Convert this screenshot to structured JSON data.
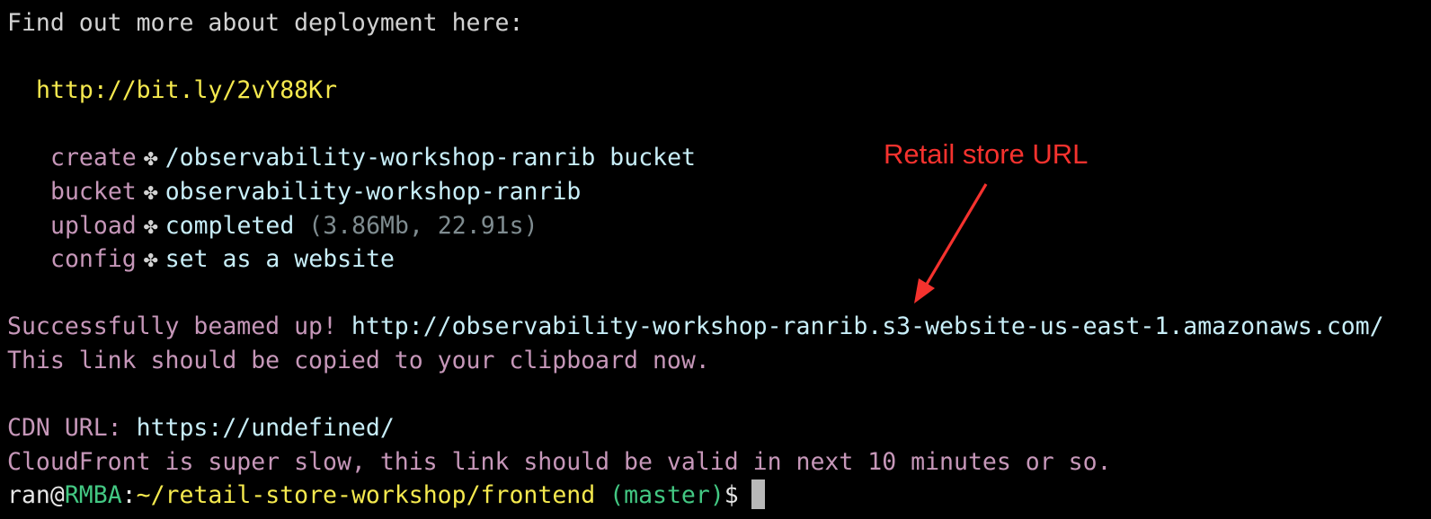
{
  "terminal": {
    "intro": "Find out more about deployment here:",
    "deploy_link": "http://bit.ly/2vY88Kr",
    "steps": [
      {
        "label": "create",
        "symbol": "✤",
        "value": "/observability-workshop-ranrib bucket",
        "extra": ""
      },
      {
        "label": "bucket",
        "symbol": "✤",
        "value": "observability-workshop-ranrib",
        "extra": ""
      },
      {
        "label": "upload",
        "symbol": "✤",
        "value": "completed",
        "extra": "(3.86Mb, 22.91s)"
      },
      {
        "label": "config",
        "symbol": "✤",
        "value": "set as a website",
        "extra": ""
      }
    ],
    "success_prefix": "Successfully beamed up!",
    "success_url": "http://observability-workshop-ranrib.s3-website-us-east-1.amazonaws.com/",
    "clipboard_note": "This link should be copied to your clipboard now.",
    "cdn_label": "CDN URL:",
    "cdn_url": "https://undefined/",
    "cloudfront_note": "CloudFront is super slow, this link should be valid in next 10 minutes or so.",
    "prompt": {
      "user": "ran",
      "at": "@",
      "host": "RMBA",
      "colon": ":",
      "path": "~/retail-store-workshop/frontend",
      "branch": "(master)",
      "symbol": "$"
    }
  },
  "annotation": {
    "label": "Retail store URL",
    "color": "#f5322e"
  },
  "colors": {
    "background": "#000000",
    "label_mauve": "#c697b9",
    "value_cyan": "#c8eef8",
    "link_yellow": "#f5e94e",
    "prompt_green": "#43c883",
    "muted_gray": "#7f8c90"
  }
}
